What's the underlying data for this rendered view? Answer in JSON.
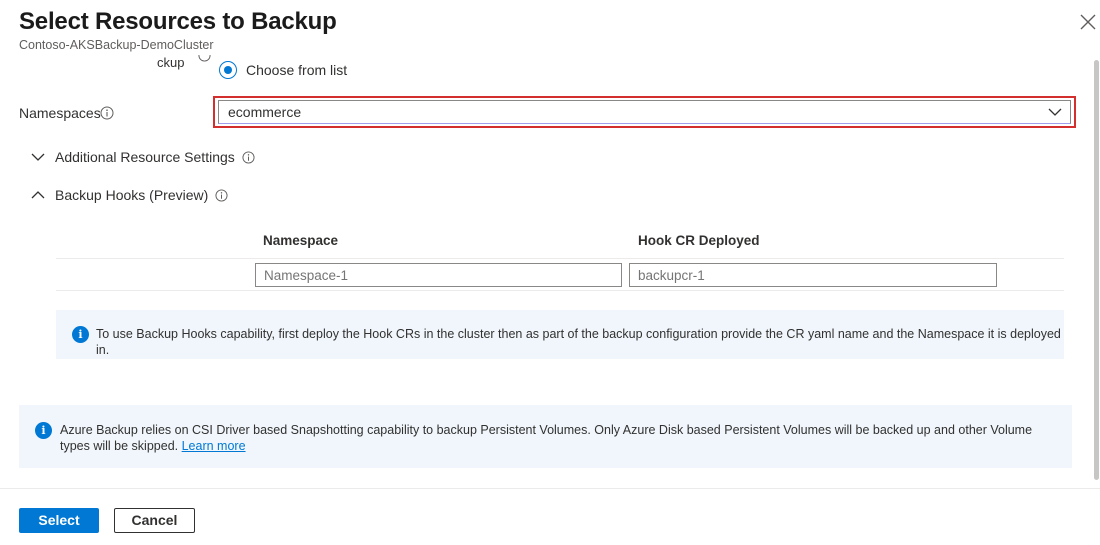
{
  "header": {
    "title": "Select Resources to Backup",
    "subtitle": "Contoso-AKSBackup-DemoCluster",
    "close_icon": "close-icon"
  },
  "scope": {
    "clipped_label": "ckup",
    "option_label": "Choose from list",
    "selected": true
  },
  "namespaces": {
    "label": "Namespaces",
    "value": "ecommerce"
  },
  "sections": {
    "additional": {
      "label": "Additional Resource Settings",
      "expanded": false
    },
    "hooks": {
      "label": "Backup Hooks (Preview)",
      "expanded": true
    }
  },
  "hooks_table": {
    "columns": [
      "Namespace",
      "Hook CR Deployed"
    ],
    "row": {
      "namespace_placeholder": "Namespace-1",
      "hook_placeholder": "backupcr-1"
    }
  },
  "hooks_info": {
    "text": "To use Backup Hooks capability, first deploy the Hook CRs in the cluster then as part of the backup configuration provide the CR yaml name and the Namespace it is deployed in."
  },
  "csi_info": {
    "text": "Azure Backup relies on CSI Driver based Snapshotting capability to backup Persistent Volumes. Only Azure Disk based Persistent Volumes will be backed up and other Volume types will be skipped.",
    "link": "Learn more"
  },
  "footer": {
    "select_label": "Select",
    "cancel_label": "Cancel"
  },
  "colors": {
    "accent": "#0078d4",
    "highlight": "#d32f2f",
    "info_bg": "#f0f6fb"
  }
}
